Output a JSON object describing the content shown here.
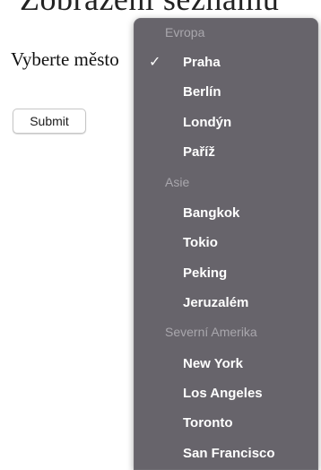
{
  "page": {
    "heading_partial": "Zobrazení seznamu",
    "select_label": "Vyberte město",
    "select_arrow_icon": "chevron-updown-icon",
    "submit_label": "Submit"
  },
  "dropdown": {
    "selected": "Praha",
    "check_icon": "checkmark-icon",
    "groups": [
      {
        "label": "Evropa",
        "options": [
          "Praha",
          "Berlín",
          "Londýn",
          "Paříž"
        ]
      },
      {
        "label": "Asie",
        "options": [
          "Bangkok",
          "Tokio",
          "Peking",
          "Jeruzalém"
        ]
      },
      {
        "label": "Severní Amerika",
        "options": [
          "New York",
          "Los Angeles",
          "Toronto",
          "San Francisco"
        ]
      }
    ]
  },
  "colors": {
    "dropdown_bg": "#67646b",
    "group_header_text": "#a9a7ad",
    "option_text": "#ffffff",
    "select_arrow_bg": "#2f7cf6"
  }
}
